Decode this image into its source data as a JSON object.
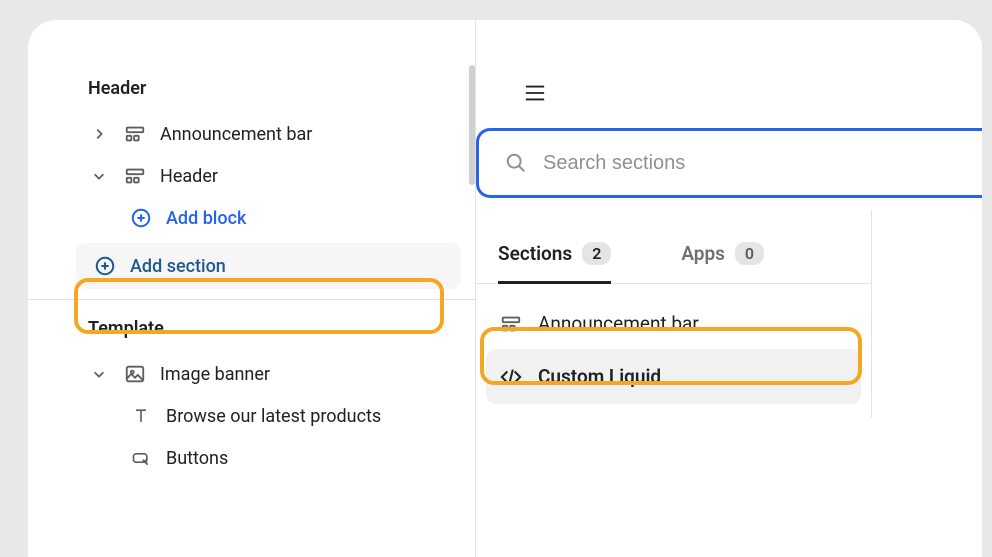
{
  "sidebar": {
    "groups": [
      {
        "label": "Header",
        "rows": [
          {
            "label": "Announcement bar"
          },
          {
            "label": "Header"
          }
        ],
        "add_block_label": "Add block",
        "add_section_label": "Add section"
      },
      {
        "label": "Template",
        "rows": [
          {
            "label": "Image banner"
          },
          {
            "label": "Browse our latest products"
          },
          {
            "label": "Buttons"
          }
        ]
      }
    ]
  },
  "search": {
    "placeholder": "Search sections"
  },
  "tabs": {
    "sections": {
      "label": "Sections",
      "count": "2"
    },
    "apps": {
      "label": "Apps",
      "count": "0"
    }
  },
  "results": [
    {
      "label": "Announcement bar"
    },
    {
      "label": "Custom Liquid"
    }
  ]
}
